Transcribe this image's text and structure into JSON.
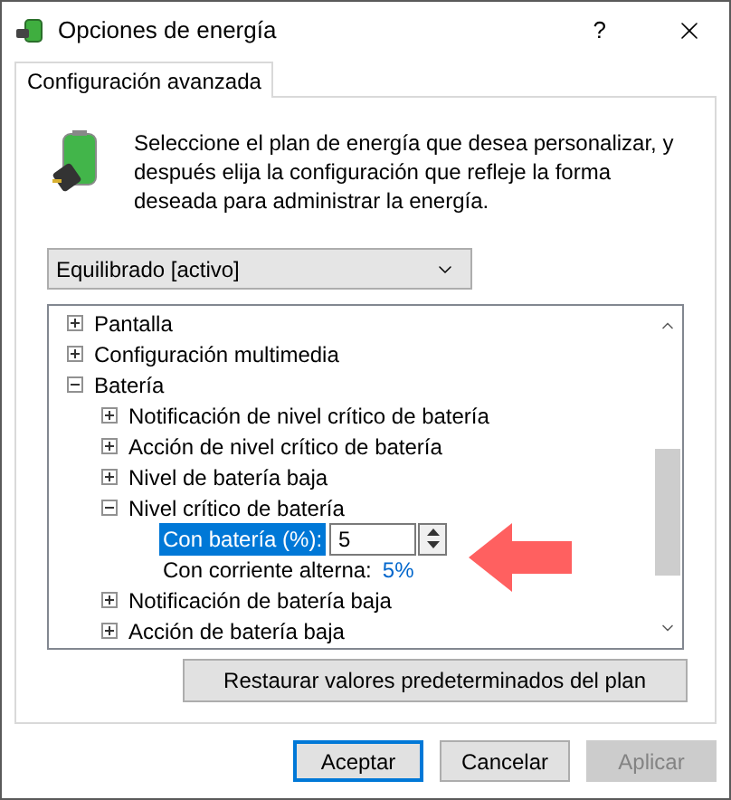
{
  "window": {
    "title": "Opciones de energía",
    "help": "?"
  },
  "tabs": [
    {
      "label": "Configuración avanzada",
      "selected": true
    }
  ],
  "description": "Seleccione el plan de energía que desea personalizar, y después elija la configuración que refleje la forma deseada para administrar la energía.",
  "plan_dropdown": {
    "value": "Equilibrado [activo]"
  },
  "tree": [
    {
      "label": "Pantalla",
      "expanded": false
    },
    {
      "label": "Configuración multimedia",
      "expanded": false
    },
    {
      "label": "Batería",
      "expanded": true,
      "children": [
        {
          "label": "Notificación de nivel crítico de batería",
          "expanded": false
        },
        {
          "label": "Acción de nivel crítico de batería",
          "expanded": false
        },
        {
          "label": "Nivel de batería baja",
          "expanded": false
        },
        {
          "label": "Nivel crítico de batería",
          "expanded": true,
          "settings": [
            {
              "kind": "spin",
              "label": "Con batería (%):",
              "value": "5",
              "selected": true
            },
            {
              "kind": "value",
              "label": "Con corriente alterna:",
              "value": "5%",
              "selected": false
            }
          ]
        },
        {
          "label": "Notificación de batería baja",
          "expanded": false
        },
        {
          "label": "Acción de batería baja",
          "expanded": false
        }
      ]
    }
  ],
  "restore_button": "Restaurar valores predeterminados del plan",
  "buttons": [
    {
      "label": "Aceptar",
      "default": true,
      "disabled": false
    },
    {
      "label": "Cancelar",
      "default": false,
      "disabled": false
    },
    {
      "label": "Aplicar",
      "default": false,
      "disabled": true
    }
  ]
}
